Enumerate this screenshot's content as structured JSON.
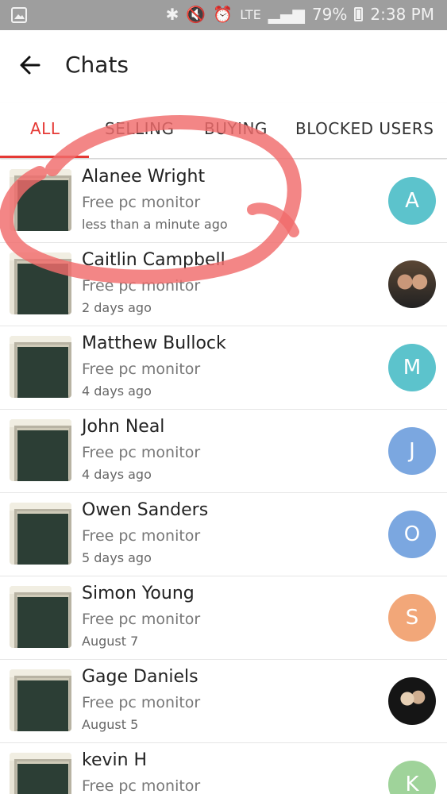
{
  "status_bar": {
    "network": "LTE",
    "battery": "79%",
    "time": "2:38 PM"
  },
  "app_bar": {
    "title": "Chats"
  },
  "tabs": [
    {
      "label": "ALL",
      "active": true
    },
    {
      "label": "SELLING",
      "active": false
    },
    {
      "label": "BUYING",
      "active": false
    },
    {
      "label": "BLOCKED USERS",
      "active": false
    }
  ],
  "chats": [
    {
      "name": "Alanee Wright",
      "item": "Free pc monitor",
      "time": "less than a minute ago",
      "avatar_letter": "A",
      "avatar_color": "#5cc3cc"
    },
    {
      "name": "Caitlin Campbell",
      "item": "Free pc monitor",
      "time": "2 days ago",
      "avatar_letter": "",
      "avatar_color": "#333333"
    },
    {
      "name": "Matthew Bullock",
      "item": "Free pc monitor",
      "time": "4 days ago",
      "avatar_letter": "M",
      "avatar_color": "#5cc3cc"
    },
    {
      "name": "John Neal",
      "item": "Free pc monitor",
      "time": "4 days ago",
      "avatar_letter": "J",
      "avatar_color": "#7ba7e0"
    },
    {
      "name": "Owen Sanders",
      "item": "Free pc monitor",
      "time": "5 days ago",
      "avatar_letter": "O",
      "avatar_color": "#7ba7e0"
    },
    {
      "name": "Simon Young",
      "item": "Free pc monitor",
      "time": "August 7",
      "avatar_letter": "S",
      "avatar_color": "#f2a779"
    },
    {
      "name": "Gage Daniels",
      "item": "Free pc monitor",
      "time": "August 5",
      "avatar_letter": "",
      "avatar_color": "#222222"
    },
    {
      "name": "kevin H",
      "item": "Free pc monitor",
      "time": "",
      "avatar_letter": "K",
      "avatar_color": "#9fd39a"
    }
  ],
  "colors": {
    "accent": "#e53935",
    "annotation": "#f06b6b"
  }
}
